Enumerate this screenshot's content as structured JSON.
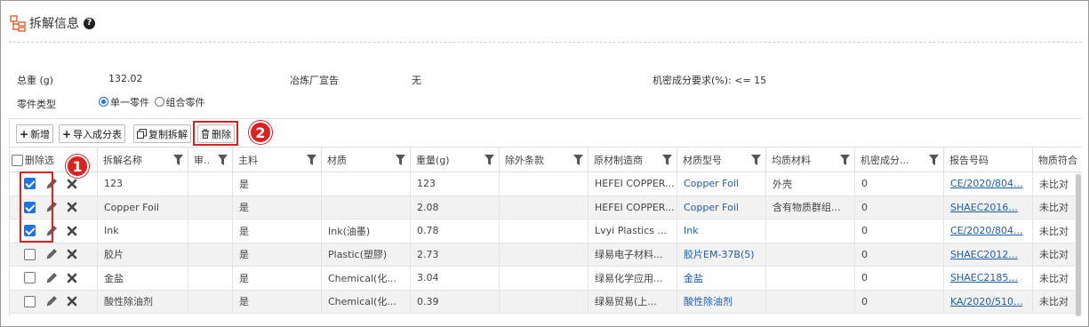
{
  "header": {
    "title": "拆解信息",
    "help_glyph": "?"
  },
  "info": {
    "total_weight_label": "总重 (g)",
    "total_weight_value": "132.02",
    "smelter_label": "冶炼厂宣告",
    "smelter_value": "无",
    "confidential_label": "机密成分要求(%):",
    "confidential_value": "<= 15",
    "part_type_label": "零件类型",
    "part_type_options": [
      "单一零件",
      "组合零件"
    ],
    "part_type_selected": "单一零件"
  },
  "toolbar": {
    "add_label": "新增",
    "import_label": "导入成分表",
    "copy_label": "复制拆解",
    "delete_label": "删除"
  },
  "annotations": [
    "1",
    "2"
  ],
  "table": {
    "columns": [
      "删除选",
      "拆解名称",
      "审..",
      "主料",
      "材质",
      "重量(g)",
      "除外条款",
      "原材制造商",
      "材质型号",
      "均质材料",
      "机密成分...",
      "报告号码",
      "物质符合"
    ],
    "rows": [
      {
        "checked": true,
        "name": "123",
        "review": "",
        "main": "是",
        "material": "",
        "weight": "123",
        "exempt": "",
        "maker": "HEFEI COPPER...",
        "model": "Copper Foil",
        "homog": "外壳",
        "conf": "0",
        "report": "CE/2020/804...",
        "comply": "未比对"
      },
      {
        "checked": true,
        "name": "Copper Foil",
        "review": "",
        "main": "是",
        "material": "",
        "weight": "2.08",
        "exempt": "",
        "maker": "HEFEI COPPER...",
        "model": "Copper Foil",
        "homog": "含有物质群组...",
        "conf": "0",
        "report": "SHAEC2016...",
        "comply": "未比对"
      },
      {
        "checked": true,
        "name": "Ink",
        "review": "",
        "main": "是",
        "material": "Ink(油墨)",
        "weight": "0.78",
        "exempt": "",
        "maker": "Lvyi Plastics ...",
        "model": "Ink",
        "homog": "",
        "conf": "0",
        "report": "CE/2020/804...",
        "comply": "未比对"
      },
      {
        "checked": false,
        "name": "胶片",
        "review": "",
        "main": "是",
        "material": "Plastic(塑膠)",
        "weight": "2.73",
        "exempt": "",
        "maker": "绿易电子材料...",
        "model": "胶片EM-37B(5)",
        "homog": "",
        "conf": "0",
        "report": "SHAEC2012...",
        "comply": "未比对"
      },
      {
        "checked": false,
        "name": "金盐",
        "review": "",
        "main": "是",
        "material": "Chemical(化...",
        "weight": "3.04",
        "exempt": "",
        "maker": "绿易化学应用...",
        "model": "金盐",
        "homog": "",
        "conf": "0",
        "report": "SHAEC2185...",
        "comply": "未比对"
      },
      {
        "checked": false,
        "name": "酸性除油剂",
        "review": "",
        "main": "是",
        "material": "Chemical(化...",
        "weight": "0.39",
        "exempt": "",
        "maker": "绿易贸易(上...",
        "model": "酸性除油剂",
        "homog": "",
        "conf": "0",
        "report": "KA/2020/510...",
        "comply": "未比对"
      }
    ]
  }
}
